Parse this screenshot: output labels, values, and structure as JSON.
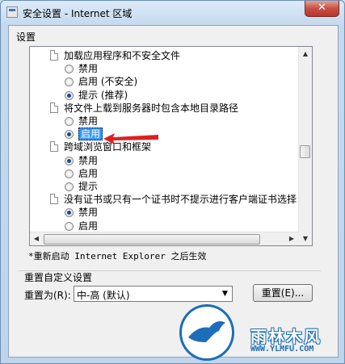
{
  "window": {
    "title": "安全设置 - Internet 区域",
    "close_label": "✕"
  },
  "settings_label": "设置",
  "list_rows": [
    {
      "type": "header",
      "text": "加载应用程序和不安全文件"
    },
    {
      "type": "radio",
      "text": "禁用",
      "checked": false
    },
    {
      "type": "radio",
      "text": "启用 (不安全)",
      "checked": false
    },
    {
      "type": "radio",
      "text": "提示 (推荐)",
      "checked": true
    },
    {
      "type": "header",
      "text": "将文件上载到服务器时包含本地目录路径"
    },
    {
      "type": "radio",
      "text": "禁用",
      "checked": false
    },
    {
      "type": "radio",
      "text": "启用",
      "checked": true,
      "selected": true
    },
    {
      "type": "header",
      "text": "跨域浏览窗口和框架"
    },
    {
      "type": "radio",
      "text": "禁用",
      "checked": true
    },
    {
      "type": "radio",
      "text": "启用",
      "checked": false
    },
    {
      "type": "radio",
      "text": "提示",
      "checked": false
    },
    {
      "type": "header",
      "text": "没有证书或只有一个证书时不提示进行客户端证书选择"
    },
    {
      "type": "radio",
      "text": "禁用",
      "checked": true
    },
    {
      "type": "radio",
      "text": "启用",
      "checked": false
    },
    {
      "type": "header",
      "text": ""
    }
  ],
  "restart_note": "*重新启动 Internet Explorer 之后生效",
  "reset_group": {
    "label": "重置自定义设置",
    "reset_to_label": "重置为(R):",
    "combo_value": "中-高 (默认)",
    "reset_button": "重置(E)..."
  },
  "watermark": {
    "title": "雨林木风",
    "url": "WWW.YLMFU.COM"
  },
  "colors": {
    "selection": "#3399ff",
    "arrow": "#e02020",
    "radio_dot": "#1a4a8c"
  }
}
